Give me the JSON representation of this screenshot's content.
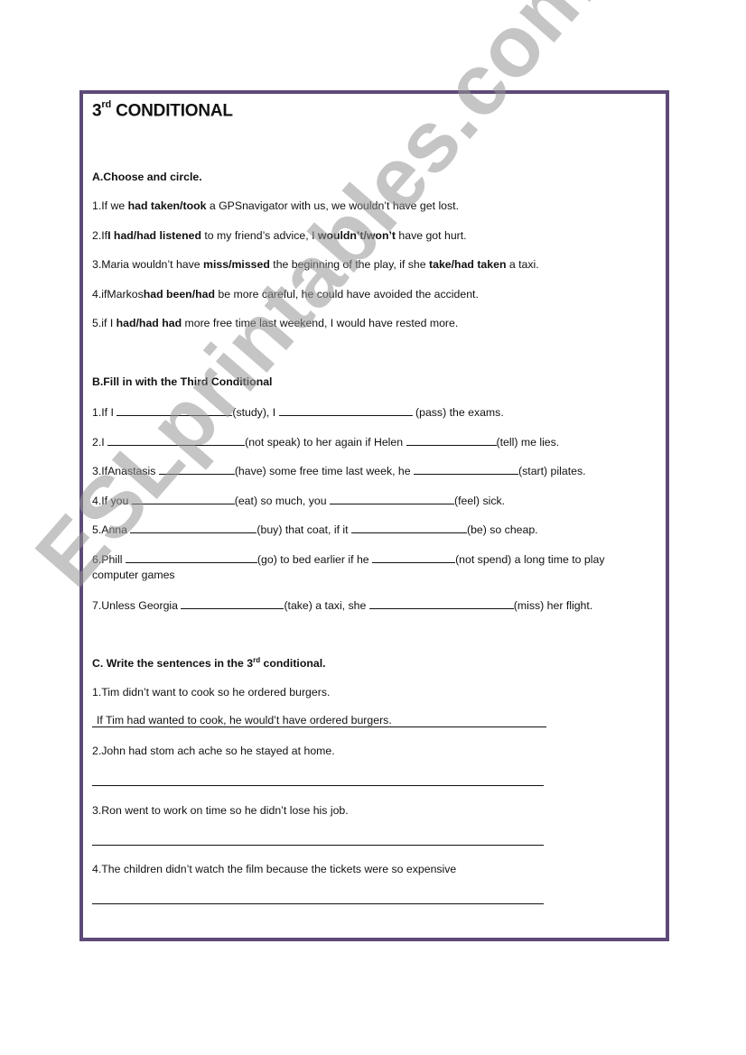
{
  "title": {
    "main": "3",
    "sup": "rd",
    "rest": " CONDITIONAL"
  },
  "colors": {
    "border": "#5e4a78",
    "watermark": "#969696"
  },
  "watermark": "ESLprintables.com",
  "sectionA": {
    "heading": "A.Choose and circle.",
    "items": [
      {
        "parts": [
          {
            "t": "1.If we "
          },
          {
            "t": "had taken/took",
            "b": true
          },
          {
            "t": " a GPSnavigator with us, we wouldn’t have get lost."
          }
        ]
      },
      {
        "parts": [
          {
            "t": "2.If"
          },
          {
            "t": "I had/had listened",
            "b": true
          },
          {
            "t": " to my friend’s advice, I "
          },
          {
            "t": "wouldn’t/won’t",
            "b": true
          },
          {
            "t": " have got hurt."
          }
        ]
      },
      {
        "parts": [
          {
            "t": "3.Maria wouldn’t have "
          },
          {
            "t": "miss/missed",
            "b": true
          },
          {
            "t": " the beginning of the play, if she "
          },
          {
            "t": "take/had taken",
            "b": true
          },
          {
            "t": " a taxi."
          }
        ]
      },
      {
        "parts": [
          {
            "t": "4.ifMarkos"
          },
          {
            "t": "had been/had",
            "b": true
          },
          {
            "t": " be more careful, he could have avoided the accident."
          }
        ]
      },
      {
        "parts": [
          {
            "t": "5.if I "
          },
          {
            "t": "had/had had",
            "b": true
          },
          {
            "t": " more free time last weekend, I would have rested more."
          }
        ]
      }
    ]
  },
  "sectionB": {
    "heading": "B.Fill in with the Third Conditional",
    "items": [
      {
        "parts": [
          {
            "t": "1.If I "
          },
          {
            "blank": 128
          },
          {
            "t": "(study), I "
          },
          {
            "blank": 148
          },
          {
            "t": " (pass) the exams."
          }
        ]
      },
      {
        "parts": [
          {
            "t": "2.I "
          },
          {
            "blank": 152
          },
          {
            "t": "(not speak) to her again if Helen "
          },
          {
            "blank": 100
          },
          {
            "t": "(tell) me lies."
          }
        ]
      },
      {
        "parts": [
          {
            "t": "3.IfAnastasis "
          },
          {
            "blank": 84
          },
          {
            "t": "(have) some free time last week, he "
          },
          {
            "blank": 116
          },
          {
            "t": "(start) pilates."
          }
        ]
      },
      {
        "parts": [
          {
            "t": "4.If you "
          },
          {
            "blank": 114
          },
          {
            "t": "(eat) so much, you "
          },
          {
            "blank": 138
          },
          {
            "t": "(feel) sick."
          }
        ]
      },
      {
        "parts": [
          {
            "t": "5.Anna "
          },
          {
            "blank": 140
          },
          {
            "t": "(buy) that coat, if it "
          },
          {
            "blank": 128
          },
          {
            "t": "(be)  so cheap."
          }
        ]
      },
      {
        "parts": [
          {
            "t": "6.Phill "
          },
          {
            "blank": 146
          },
          {
            "t": "(go) to bed earlier if he "
          },
          {
            "blank": 92
          },
          {
            "t": "(not spend) a long time to play"
          }
        ],
        "cont": "computer games"
      },
      {
        "parts": [
          {
            "t": "7.Unless Georgia "
          },
          {
            "blank": 114
          },
          {
            "t": "(take) a taxi, she "
          },
          {
            "blank": 160
          },
          {
            "t": "(miss) her flight."
          }
        ]
      }
    ]
  },
  "sectionC": {
    "heading_pre": "C. Write the sentences in the 3",
    "heading_sup": "rd",
    "heading_post": " conditional.",
    "items": [
      {
        "prompt": "1.Tim didn’t want to cook so he ordered burgers.",
        "answer": "If Tim had wanted to cook, he would’t have ordered burgers."
      },
      {
        "prompt": "2.John had stom ach ache so he stayed at home.",
        "answer": ""
      },
      {
        "prompt": "3.Ron went to work on time so he didn’t lose his job.",
        "answer": ""
      },
      {
        "prompt": "4.The children didn’t watch the film because the tickets were so expensive",
        "answer": ""
      }
    ]
  }
}
